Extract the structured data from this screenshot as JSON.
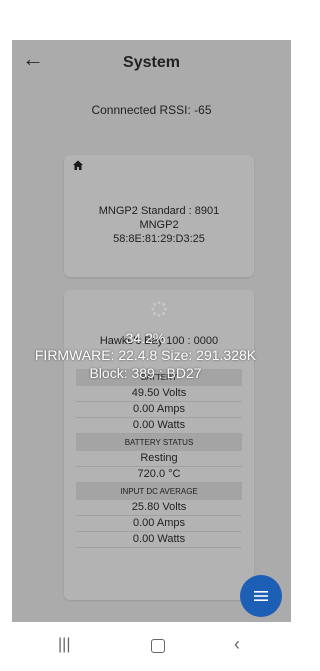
{
  "header": {
    "title": "System"
  },
  "connection": {
    "rssi_text": "Connnected RSSI: -65"
  },
  "device": {
    "model_line": "MNGP2 Standard : 8901",
    "name": "MNGP2",
    "mac": "58:8E:81:29:D3:25"
  },
  "device2": {
    "hawkes_line": "Hawke's Bay 100 : 0000"
  },
  "battery": {
    "title": "BATTERY",
    "rows": [
      "49.50 Volts",
      "0.00 Amps",
      "0.00 Watts"
    ]
  },
  "battery_status": {
    "title": "BATTERY STATUS",
    "rows": [
      "Resting",
      "720.0 °C"
    ]
  },
  "input_dc": {
    "title": "INPUT DC AVERAGE",
    "rows": [
      "25.80 Volts",
      "0.00 Amps",
      "0.00 Watts"
    ]
  },
  "update": {
    "progress_text": "34.2%",
    "progress": 0.342,
    "firmware_text": "FIRMWARE: 22.4.8 Size: 291.328K",
    "block_text": "Block: 389 : BD27"
  },
  "icons": {
    "back": "arrow-left-icon",
    "home": "home-icon",
    "spinner": "loading-spinner-icon",
    "fab": "menu-icon",
    "nav_recent": "recent-apps-icon",
    "nav_home": "home-button-icon",
    "nav_back": "back-chevron-icon"
  },
  "colors": {
    "fab": "#1d5fb5",
    "screen_bg": "#dcdcdc",
    "overlay_text": "#ffffff"
  }
}
